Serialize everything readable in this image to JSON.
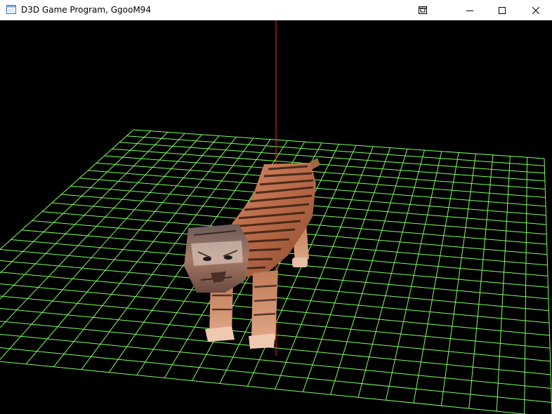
{
  "window": {
    "title": "D3D Game Program, GgooM94"
  },
  "titlebar_buttons": {
    "special_icon": "window-overlay-icon",
    "minimize_icon": "minimize-icon",
    "maximize_icon": "maximize-icon",
    "close_icon": "close-icon"
  },
  "scene": {
    "background_color": "#000000",
    "grid_color": "#7dff5a",
    "axis_color": "#ff2020",
    "model": "tiger"
  }
}
